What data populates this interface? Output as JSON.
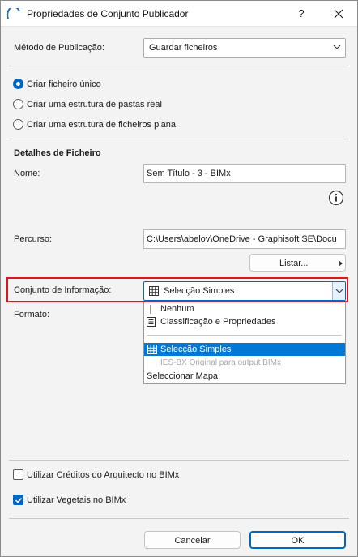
{
  "window": {
    "title": "Propriedades de Conjunto Publicador",
    "help_label": "?"
  },
  "publish_method": {
    "label": "Método de Publicação:",
    "value": "Guardar ficheiros"
  },
  "options": [
    {
      "label": "Criar ficheiro único",
      "checked": true
    },
    {
      "label": "Criar uma estrutura de pastas real",
      "checked": false
    },
    {
      "label": "Criar uma estrutura de ficheiros plana",
      "checked": false
    }
  ],
  "file_details": {
    "heading": "Detalhes de Ficheiro",
    "name_label": "Nome:",
    "name_value": "Sem Título - 3 - BIMx",
    "path_label": "Percurso:",
    "path_value": "C:\\Users\\abelov\\OneDrive - Graphisoft SE\\Docu",
    "browse_label": "Listar..."
  },
  "info_set": {
    "label": "Conjunto de Informação:",
    "value": "Selecção Simples",
    "format_label": "Formato:",
    "menu": {
      "none": "Nenhum",
      "classification": "Classificação e Propriedades",
      "simple": "Selecção Simples",
      "ies": "IES-BX Original para output BIMx",
      "select_map": "Seleccionar Mapa:"
    }
  },
  "checkboxes": [
    {
      "label": "Utilizar Créditos do Arquitecto no BIMx",
      "checked": false
    },
    {
      "label": "Utilizar Vegetais no BIMx",
      "checked": true
    }
  ],
  "buttons": {
    "cancel": "Cancelar",
    "ok": "OK"
  },
  "colors": {
    "accent": "#0067c0",
    "highlight_border": "#e0141c",
    "selection": "#0078d7"
  }
}
